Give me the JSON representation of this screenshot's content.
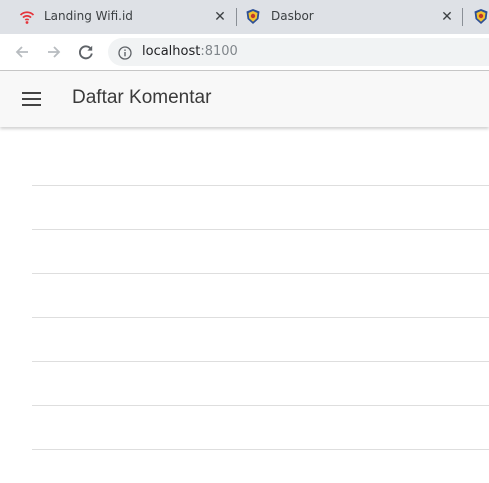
{
  "browser": {
    "tabs": [
      {
        "title": "Landing Wifi.id",
        "icon": "wifi-icon"
      },
      {
        "title": "Dasbor",
        "icon": "emblem-icon"
      },
      {
        "title": "",
        "icon": "emblem-icon"
      }
    ],
    "close_glyph": "✕",
    "address": {
      "host": "localhost",
      "port": ":8100"
    }
  },
  "app": {
    "title": "Daftar Komentar",
    "menu_icon": "hamburger-menu-icon"
  },
  "comments": [
    {
      "text": ""
    },
    {
      "text": ""
    },
    {
      "text": ""
    },
    {
      "text": ""
    },
    {
      "text": ""
    },
    {
      "text": ""
    },
    {
      "text": ""
    }
  ]
}
